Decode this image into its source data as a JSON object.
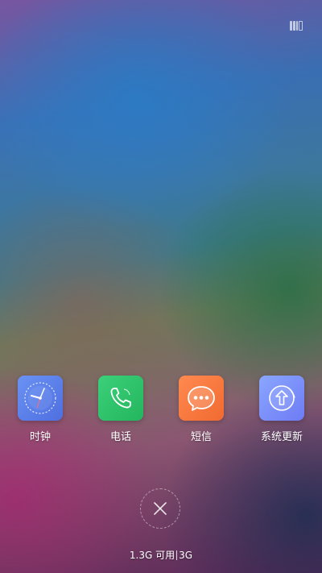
{
  "apps": [
    {
      "name": "clock",
      "label": "时钟",
      "icon": "clock-icon",
      "color": "#5b7ff0"
    },
    {
      "name": "phone",
      "label": "电话",
      "icon": "phone-icon",
      "color": "#2fc26b"
    },
    {
      "name": "sms",
      "label": "短信",
      "icon": "chat-bubble-icon",
      "color": "#f7783d"
    },
    {
      "name": "system-update",
      "label": "系统更新",
      "icon": "upload-arrow-icon",
      "color": "#7c8df8"
    }
  ],
  "memory": {
    "available": "1.3G 可用",
    "total": "3G"
  },
  "controls": {
    "close_icon": "close-icon",
    "memory_icon": "memory-usage-icon"
  }
}
